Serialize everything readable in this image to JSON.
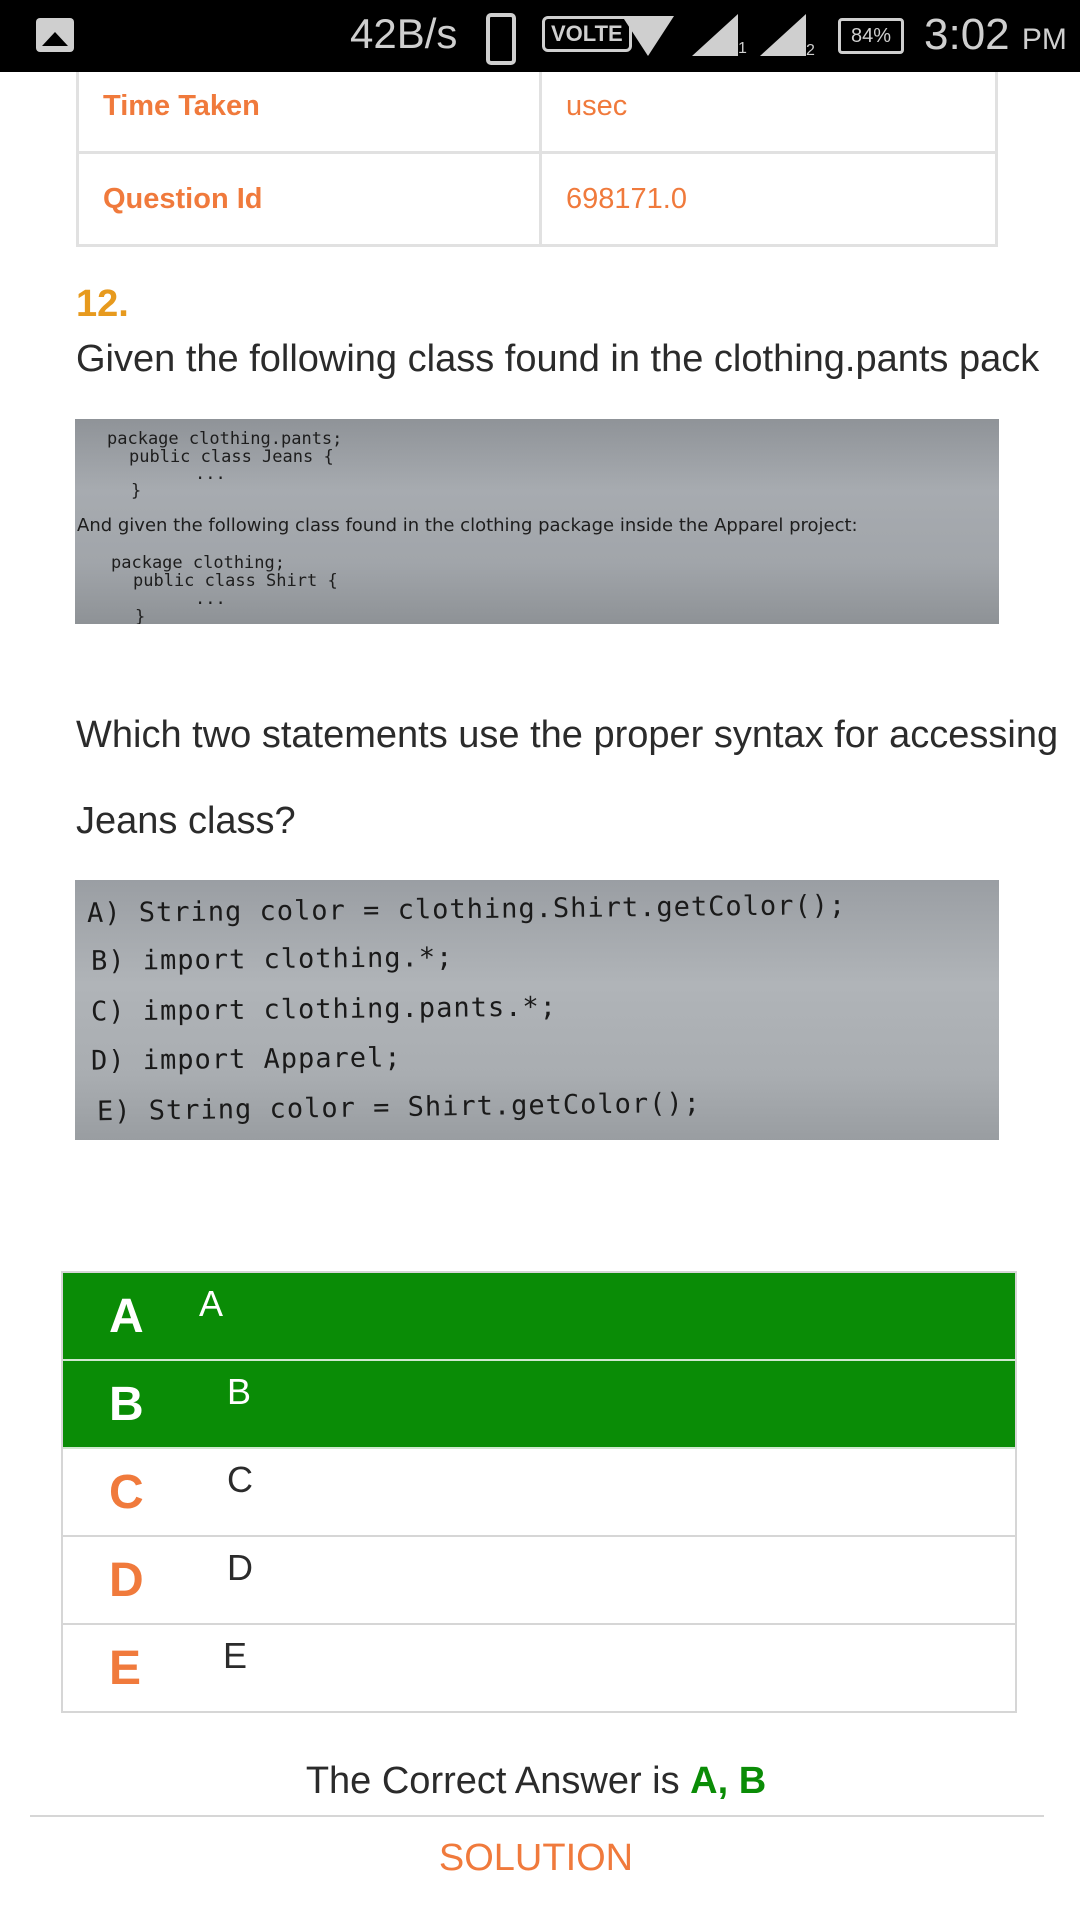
{
  "status_bar": {
    "speed": "42B/s",
    "volte": "VOLTE",
    "sim1": "1",
    "sim2": "2",
    "battery": "84%",
    "time": "3:02",
    "ampm": "PM",
    "icons": [
      "gallery-icon",
      "phone-icon",
      "wifi-icon",
      "signal-icon",
      "battery-icon"
    ]
  },
  "info_table": {
    "rows": [
      {
        "key": "Time Taken",
        "value": "usec"
      },
      {
        "key": "Question Id",
        "value": "698171.0"
      }
    ]
  },
  "question": {
    "number": "12.",
    "text": "Given the following class found in the clothing.pants pack",
    "text2": "Which two statements use the proper syntax for accessing",
    "text3": "Jeans class?"
  },
  "image1": {
    "lines": [
      "package clothing.pants;",
      "public class Jeans {",
      "...",
      "}"
    ],
    "sentence": "And given the following class found in the clothing package inside the Apparel project:",
    "lines2": [
      "package clothing;",
      "public class Shirt {",
      "...",
      "}"
    ]
  },
  "image2": {
    "options": [
      "A) String color = clothing.Shirt.getColor();",
      "B) import clothing.*;",
      "C) import clothing.pants.*;",
      "D) import Apparel;",
      "E) String color = Shirt.getColor();"
    ]
  },
  "answers": [
    {
      "letter": "A",
      "text": "A",
      "correct": true
    },
    {
      "letter": "B",
      "text": "B",
      "correct": true
    },
    {
      "letter": "C",
      "text": "C",
      "correct": false
    },
    {
      "letter": "D",
      "text": "D",
      "correct": false
    },
    {
      "letter": "E",
      "text": "E",
      "correct": false
    }
  ],
  "result": {
    "prefix": "The Correct Answer is ",
    "answer": "A, B"
  },
  "solution_label": "SOLUTION",
  "colors": {
    "accent": "#f07a3c",
    "correct": "#0a8c06",
    "number": "#e79a1e"
  }
}
